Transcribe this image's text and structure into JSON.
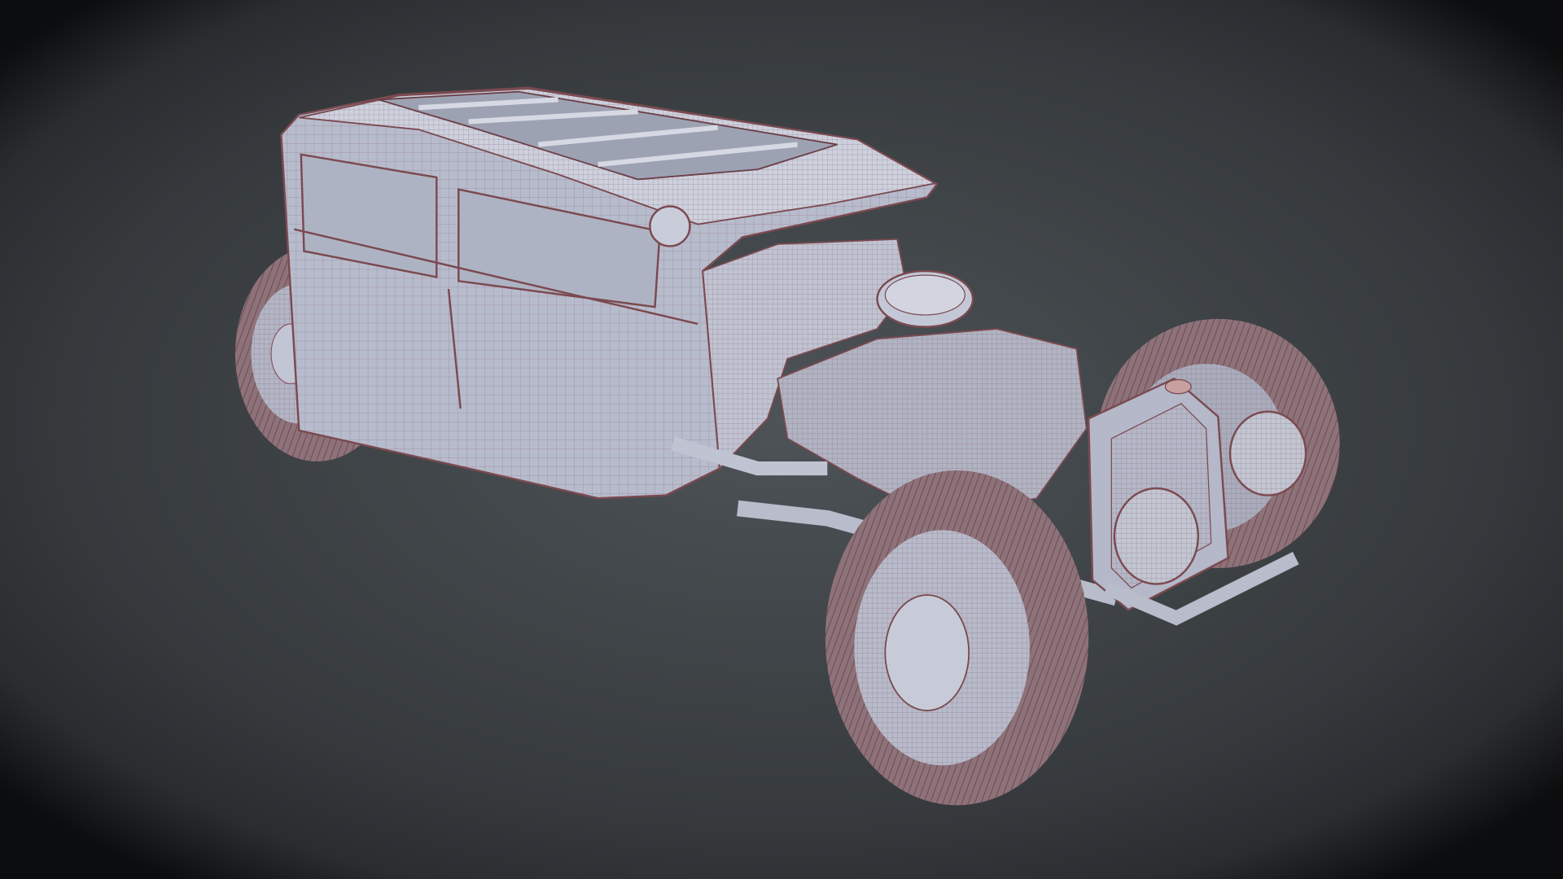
{
  "colors": {
    "background_center": "#4d5357",
    "background_edge": "#2a2d30",
    "vignette": "#0c0d0e",
    "body_fill": "#b7bccd",
    "body_light": "#cdd1de",
    "glass": "#aeb3c3",
    "wire": "#8a5560",
    "tire": "#8e7279"
  }
}
